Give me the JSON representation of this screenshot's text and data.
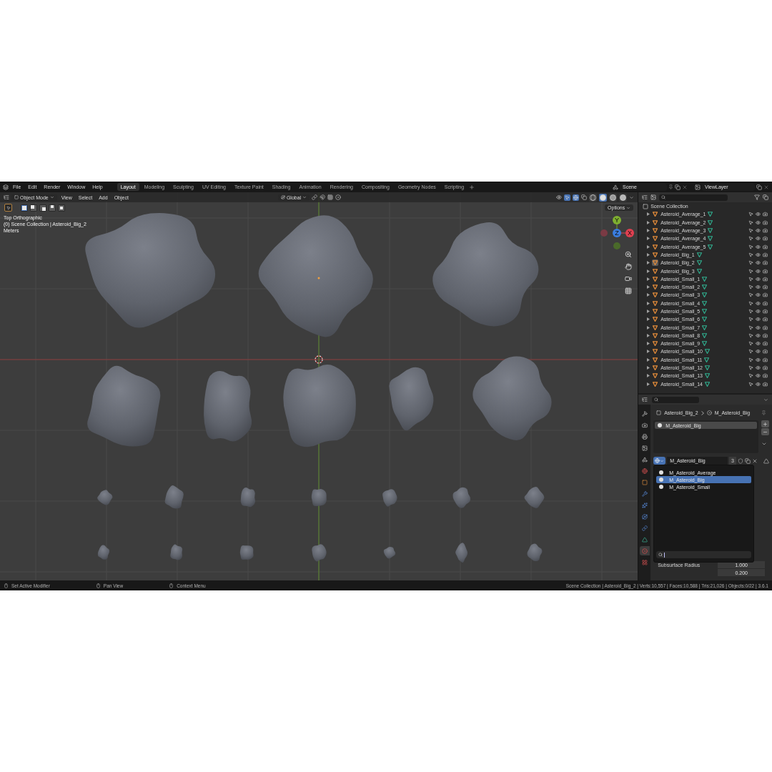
{
  "menu": [
    "File",
    "Edit",
    "Render",
    "Window",
    "Help"
  ],
  "workspaces": [
    {
      "label": "Layout",
      "selected": true
    },
    {
      "label": "Modeling",
      "selected": false
    },
    {
      "label": "Sculpting",
      "selected": false
    },
    {
      "label": "UV Editing",
      "selected": false
    },
    {
      "label": "Texture Paint",
      "selected": false
    },
    {
      "label": "Shading",
      "selected": false
    },
    {
      "label": "Animation",
      "selected": false
    },
    {
      "label": "Rendering",
      "selected": false
    },
    {
      "label": "Compositing",
      "selected": false
    },
    {
      "label": "Geometry Nodes",
      "selected": false
    },
    {
      "label": "Scripting",
      "selected": false
    }
  ],
  "scene": "Scene",
  "view_layer": "ViewLayer",
  "viewport": {
    "mode": "Object Mode",
    "menus": [
      "View",
      "Select",
      "Add",
      "Object"
    ],
    "transform_orientation": "Global",
    "options": "Options",
    "select_modes": [
      {
        "kind": "set",
        "selected": true
      },
      {
        "kind": "extend",
        "selected": false
      },
      {
        "kind": "subtract",
        "selected": false
      },
      {
        "kind": "invert",
        "selected": false
      },
      {
        "kind": "intersect",
        "selected": false
      }
    ],
    "shading_modes": [
      {
        "kind": "wireframe",
        "selected": false
      },
      {
        "kind": "solid",
        "selected": true
      },
      {
        "kind": "material",
        "selected": false
      },
      {
        "kind": "rendered",
        "selected": false
      }
    ],
    "overlay": [
      "Top Orthographic",
      "(0) Scene Collection | Asteroid_Big_2",
      "Meters"
    ],
    "gizmo_axes": [
      "Y",
      "Z",
      "X"
    ]
  },
  "outliner": {
    "root": "Scene Collection",
    "items": [
      {
        "name": "Asteroid_Average_1",
        "selected": false
      },
      {
        "name": "Asteroid_Average_2",
        "selected": false
      },
      {
        "name": "Asteroid_Average_3",
        "selected": false
      },
      {
        "name": "Asteroid_Average_4",
        "selected": false
      },
      {
        "name": "Asteroid_Average_5",
        "selected": false
      },
      {
        "name": "Asteroid_Big_1",
        "selected": false
      },
      {
        "name": "Asteroid_Big_2",
        "selected": true
      },
      {
        "name": "Asteroid_Big_3",
        "selected": false
      },
      {
        "name": "Asteroid_Small_1",
        "selected": false
      },
      {
        "name": "Asteroid_Small_2",
        "selected": false
      },
      {
        "name": "Asteroid_Small_3",
        "selected": false
      },
      {
        "name": "Asteroid_Small_4",
        "selected": false
      },
      {
        "name": "Asteroid_Small_5",
        "selected": false
      },
      {
        "name": "Asteroid_Small_6",
        "selected": false
      },
      {
        "name": "Asteroid_Small_7",
        "selected": false
      },
      {
        "name": "Asteroid_Small_8",
        "selected": false
      },
      {
        "name": "Asteroid_Small_9",
        "selected": false
      },
      {
        "name": "Asteroid_Small_10",
        "selected": false
      },
      {
        "name": "Asteroid_Small_11",
        "selected": false
      },
      {
        "name": "Asteroid_Small_12",
        "selected": false
      },
      {
        "name": "Asteroid_Small_13",
        "selected": false
      },
      {
        "name": "Asteroid_Small_14",
        "selected": false
      }
    ]
  },
  "properties": {
    "tabs": [
      {
        "kind": "tool",
        "selected": false
      },
      {
        "kind": "render",
        "selected": false
      },
      {
        "kind": "output",
        "selected": false
      },
      {
        "kind": "view_layer",
        "selected": false
      },
      {
        "kind": "scene",
        "selected": false
      },
      {
        "kind": "world",
        "selected": false
      },
      {
        "kind": "object",
        "selected": false
      },
      {
        "kind": "modifier",
        "selected": false
      },
      {
        "kind": "particles",
        "selected": false
      },
      {
        "kind": "physics",
        "selected": false
      },
      {
        "kind": "constraints",
        "selected": false
      },
      {
        "kind": "data",
        "selected": false
      },
      {
        "kind": "material",
        "selected": true
      },
      {
        "kind": "texture",
        "selected": false
      }
    ],
    "breadcrumb": [
      "Asteroid_Big_2",
      "M_Asteroid_Big"
    ],
    "slots": [
      {
        "name": "M_Asteroid_Big",
        "selected": true
      }
    ],
    "material": "M_Asteroid_Big",
    "users": "3",
    "browse_list": [
      {
        "name": "M_Asteroid_Average",
        "selected": false
      },
      {
        "name": "M_Asteroid_Big",
        "selected": true
      },
      {
        "name": "M_Asteroid_Small",
        "selected": false
      }
    ],
    "fields": [
      {
        "label": "Subsurface Radius",
        "value": "1.000"
      },
      {
        "value": "0.200"
      }
    ]
  },
  "status_bar": {
    "hints": [
      "Set Active Modifier",
      "Pan View",
      "Context Menu"
    ],
    "stats": "Scene Collection | Asteroid_Big_2 | Verts:10,557 | Faces:10,588 | Tris:21,026 | Objects:0/22 | 3.6.1"
  }
}
